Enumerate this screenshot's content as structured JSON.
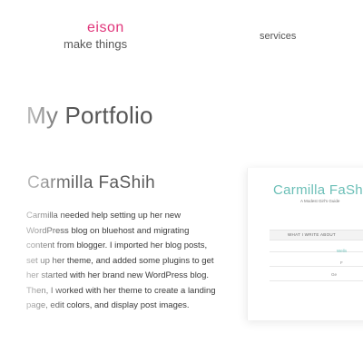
{
  "header": {
    "brand_name": "eison",
    "brand_tagline": "make things",
    "nav_services": "services"
  },
  "main": {
    "page_title": "My Portfolio",
    "project": {
      "title": "Carmilla FaShih",
      "description": "Carmilla needed help setting up her new WordPress blog on bluehost and migrating content from blogger. I imported her blog posts, set up her theme, and added some plugins to get her started with her brand new WordPress blog. Then, I worked with her theme to create a landing page, edit colors, and display post images."
    },
    "preview": {
      "blog_title": "Carmilla FaSh",
      "blog_subtitle": "A Modest Girl's Guide",
      "menu_label": "WHAT I WRITE ABOUT",
      "snippet_1": "Welln",
      "snippet_2": "F",
      "snippet_3": "Ge"
    }
  },
  "colors": {
    "brand_accent": "#e0357a",
    "preview_title_color": "#6bbfb7",
    "text": "#3a3a3a"
  }
}
